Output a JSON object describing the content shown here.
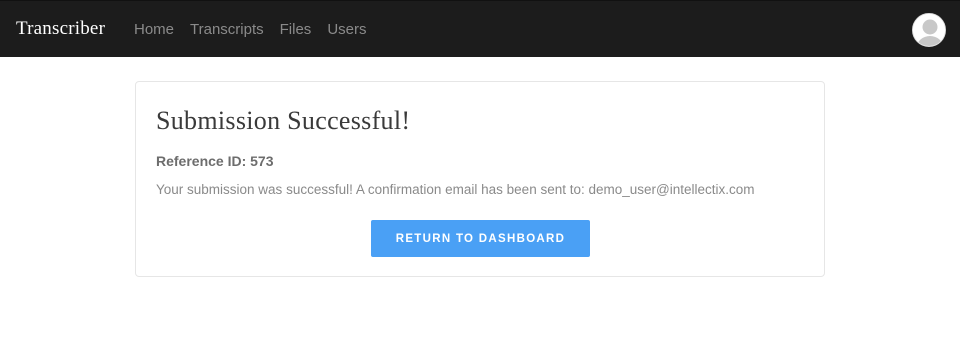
{
  "navbar": {
    "brand": "Transcriber",
    "links": [
      {
        "label": "Home"
      },
      {
        "label": "Transcripts"
      },
      {
        "label": "Files"
      },
      {
        "label": "Users"
      }
    ],
    "avatar_icon": "user-avatar-icon"
  },
  "card": {
    "title": "Submission Successful!",
    "reference": "Reference ID: 573",
    "message": "Your submission was successful! A confirmation email has been sent to: demo_user@intellectix.com",
    "button_label": "RETURN TO DASHBOARD"
  },
  "colors": {
    "navbar_bg": "#1c1c1c",
    "button_bg": "#4aa0f5",
    "nav_link": "#8a8a8a"
  }
}
